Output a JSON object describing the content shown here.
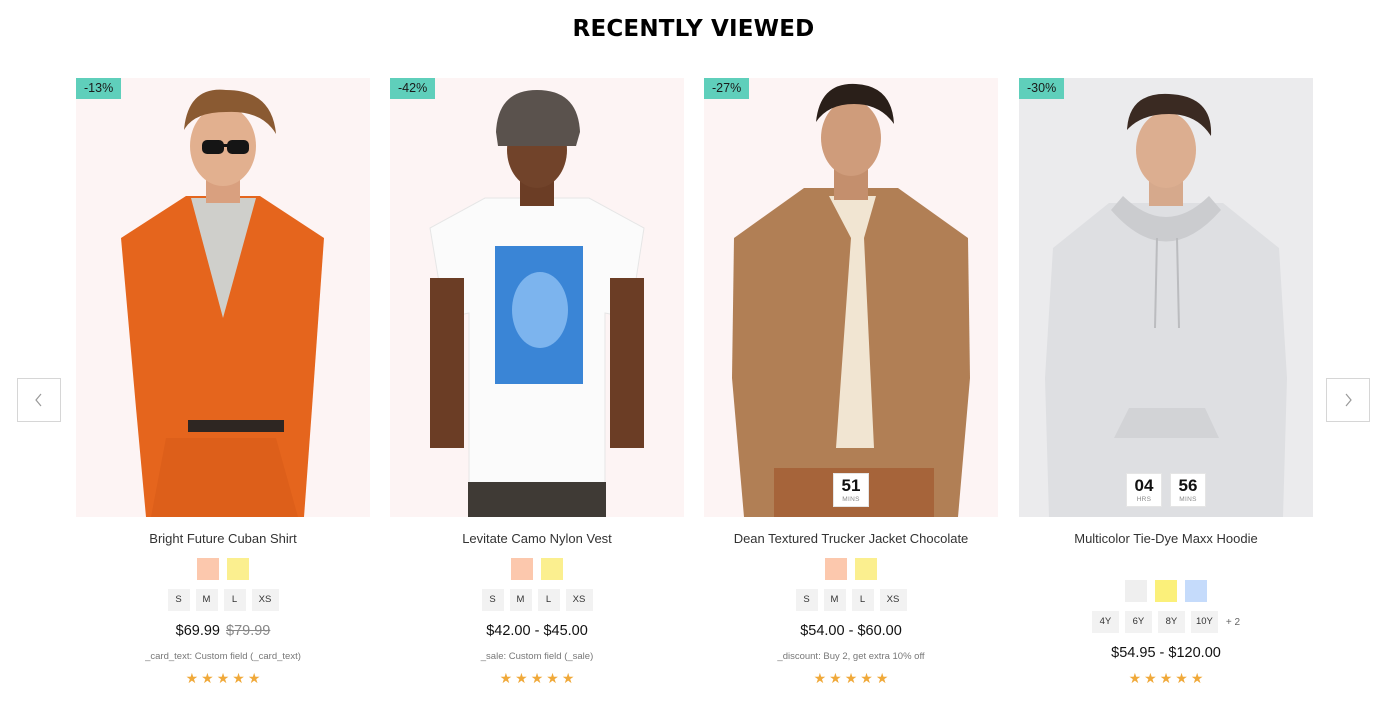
{
  "section": {
    "title": "RECENTLY VIEWED"
  },
  "products": [
    {
      "badge": "-13%",
      "title": "Bright Future Cuban Shirt",
      "colors": [
        "#fcc8ad",
        "#fbef8f"
      ],
      "sizes": [
        "S",
        "M",
        "L",
        "XS"
      ],
      "price": "$69.99",
      "old_price": "$79.99",
      "note": "_card_text: Custom field (_card_text)",
      "rating": 5
    },
    {
      "badge": "-42%",
      "title": "Levitate Camo Nylon Vest",
      "colors": [
        "#fcc8ad",
        "#fbef8f"
      ],
      "sizes": [
        "S",
        "M",
        "L",
        "XS"
      ],
      "price": "$42.00 - $45.00",
      "note": "_sale: Custom field (_sale)",
      "rating": 5
    },
    {
      "badge": "-27%",
      "title": "Dean Textured Trucker Jacket Chocolate",
      "colors": [
        "#fcc8ad",
        "#fbef8f"
      ],
      "sizes": [
        "S",
        "M",
        "L",
        "XS"
      ],
      "price": "$54.00 - $60.00",
      "note": "_discount: Buy 2, get extra 10% off",
      "rating": 5,
      "countdown": [
        {
          "value": "51",
          "unit": "MINS"
        }
      ]
    },
    {
      "badge": "-30%",
      "title": "Multicolor Tie-Dye Maxx Hoodie",
      "colors": [
        "#efefef",
        "#fbf07a",
        "#c5dbfb"
      ],
      "sizes": [
        "4Y",
        "6Y",
        "8Y",
        "10Y"
      ],
      "more_sizes": "+ 2",
      "price": "$54.95 - $120.00",
      "rating": 5,
      "countdown": [
        {
          "value": "04",
          "unit": "HRS"
        },
        {
          "value": "56",
          "unit": "MINS"
        }
      ]
    }
  ],
  "theme": {
    "badge_color": "#5fcfbb",
    "star_color": "#f0a93a"
  }
}
